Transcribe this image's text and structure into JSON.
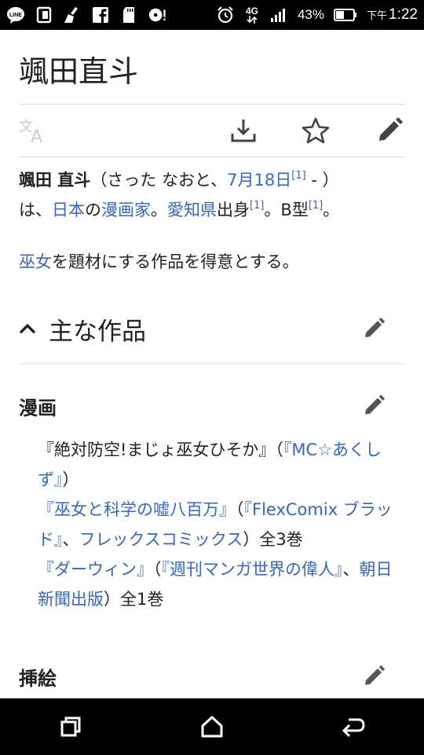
{
  "status_bar": {
    "left_icons": [
      "line-icon",
      "sim-icon",
      "broom-icon",
      "facebook-icon",
      "sd-card-icon",
      "disc-alert-icon"
    ],
    "line_label": "LINE",
    "network": "4G",
    "battery": "43%",
    "time_prefix": "下午",
    "time": "1:22"
  },
  "article": {
    "title": "颯田直斗",
    "toolbar": {
      "icons": [
        "translate-icon",
        "download-icon",
        "star-icon",
        "edit-icon"
      ]
    },
    "intro": {
      "name": "颯田 直斗",
      "reading": "（さった なおと、",
      "birthday": "7月18日",
      "ref1": "[1]",
      "dash": " - ）",
      "wa": "は、",
      "japan": "日本",
      "no": "の",
      "mangaka": "漫画家",
      "maru1": "。",
      "aichi": "愛知県",
      "shusshin": "出身",
      "ref2": "[1]",
      "btype": "。B型",
      "ref3": "[1]",
      "maru2": "。"
    },
    "line2": {
      "miko": "巫女",
      "rest": "を題材にする作品を得意とする。"
    },
    "section_main": {
      "title": "主な作品"
    },
    "sub_manga": {
      "title": "漫画",
      "works": [
        {
          "open": "『",
          "title": "絶対防空!まじょ巫女ひそか",
          "close": "』（",
          "mag": "『MC☆あくしず』",
          "end": "）"
        },
        {
          "title": "『巫女と科学の嘘八百万』",
          "mid": "（",
          "mag": "『FlexComix ブラッド』",
          "sep": "、",
          "pub": "フレックスコミックス",
          "end": "）全3巻"
        },
        {
          "title": "『ダーウィン』",
          "mid": "（",
          "mag": "『週刊マンガ世界の偉人』",
          "sep": "、",
          "pub": "朝日新聞出版",
          "end": "）全1巻"
        }
      ]
    },
    "sub_illust": {
      "title": "挿絵"
    }
  },
  "nav_bar": {
    "buttons": [
      "recents-icon",
      "home-icon",
      "back-icon"
    ]
  },
  "colors": {
    "link": "#3366cc",
    "text": "#222222",
    "icon": "#444444",
    "bars": "#000000"
  }
}
